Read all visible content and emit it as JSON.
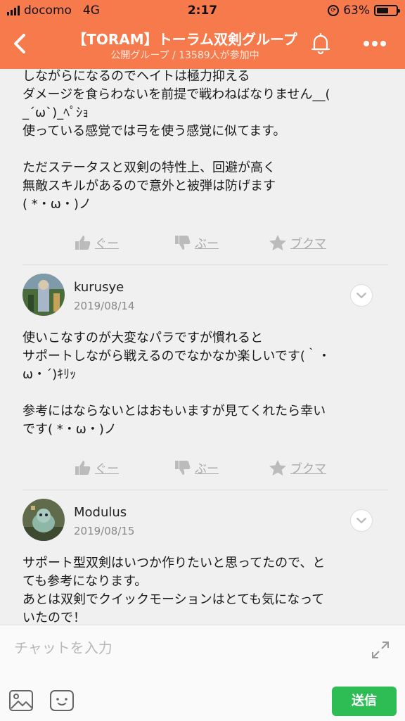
{
  "status": {
    "carrier": "docomo",
    "network": "4G",
    "time": "2:17",
    "battery": "63%",
    "battery_level": 0.63
  },
  "header": {
    "title": "【TORAM】トーラム双剣グループ",
    "subtitle": "公開グループ / 13589人が参加中",
    "back_icon": "chevron-left-icon",
    "bell_icon": "bell-icon",
    "more_icon": "more-dots-icon"
  },
  "posts": [
    {
      "text": "しながらになるのでヘイトは極力抑える\nダメージを食らわないを前提で戦わねばなりません__(\n_´ω`)_ﾍﾟｼｮ\n使っている感覚では弓を使う感覚に似てます。\n\nただステータスと双剣の特性上、回避が高く\n無敵スキルがあるので意外と被弾は防げます\n( *・ω・)ノ",
      "actions": {
        "like": "ぐー",
        "dislike": "ぶー",
        "bookmark": "ブクマ"
      }
    },
    {
      "user": "kurusye",
      "date": "2019/08/14",
      "text": "使いこなすのが大変なパラですが慣れると\nサポートしながら戦えるのでなかなか楽しいです(｀・\nω・´)ｷﾘｯ\n\n参考にはならないとはおもいますが見てくれたら幸い\nです( *・ω・)ノ",
      "actions": {
        "like": "ぐー",
        "dislike": "ぶー",
        "bookmark": "ブクマ"
      }
    },
    {
      "user": "Modulus",
      "date": "2019/08/15",
      "text": "サポート型双剣はいつか作りたいと思ってたので、と\nても参考になります。\nあとは双剣でクイックモーションはとても気になって\nいたので！"
    }
  ],
  "composer": {
    "placeholder": "チャットを入力",
    "send_label": "送信"
  },
  "colors": {
    "accent": "#f77a4c",
    "send": "#2ebd54"
  }
}
